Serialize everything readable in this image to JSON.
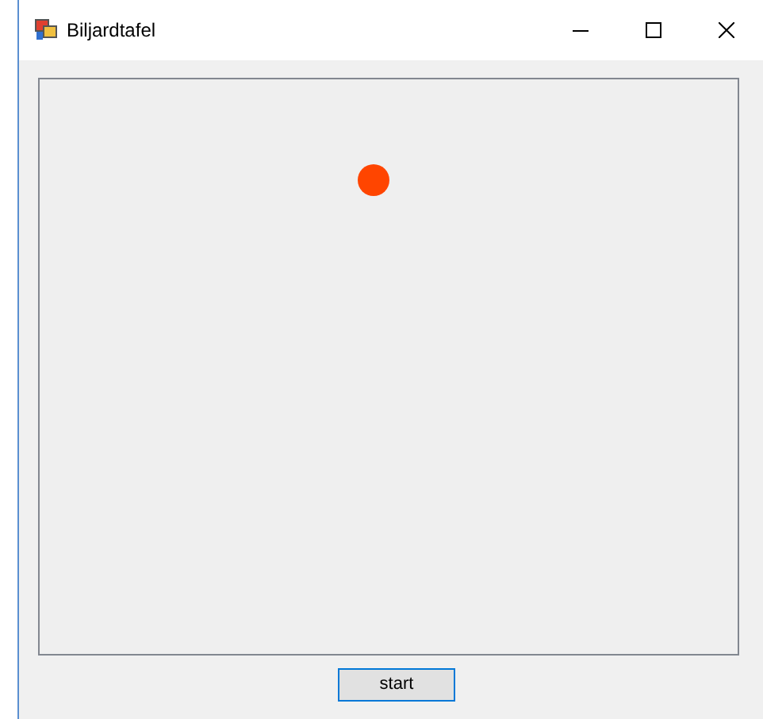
{
  "window": {
    "title": "Biljardtafel"
  },
  "buttons": [
    {
      "label": "start",
      "focused": true
    }
  ]
}
